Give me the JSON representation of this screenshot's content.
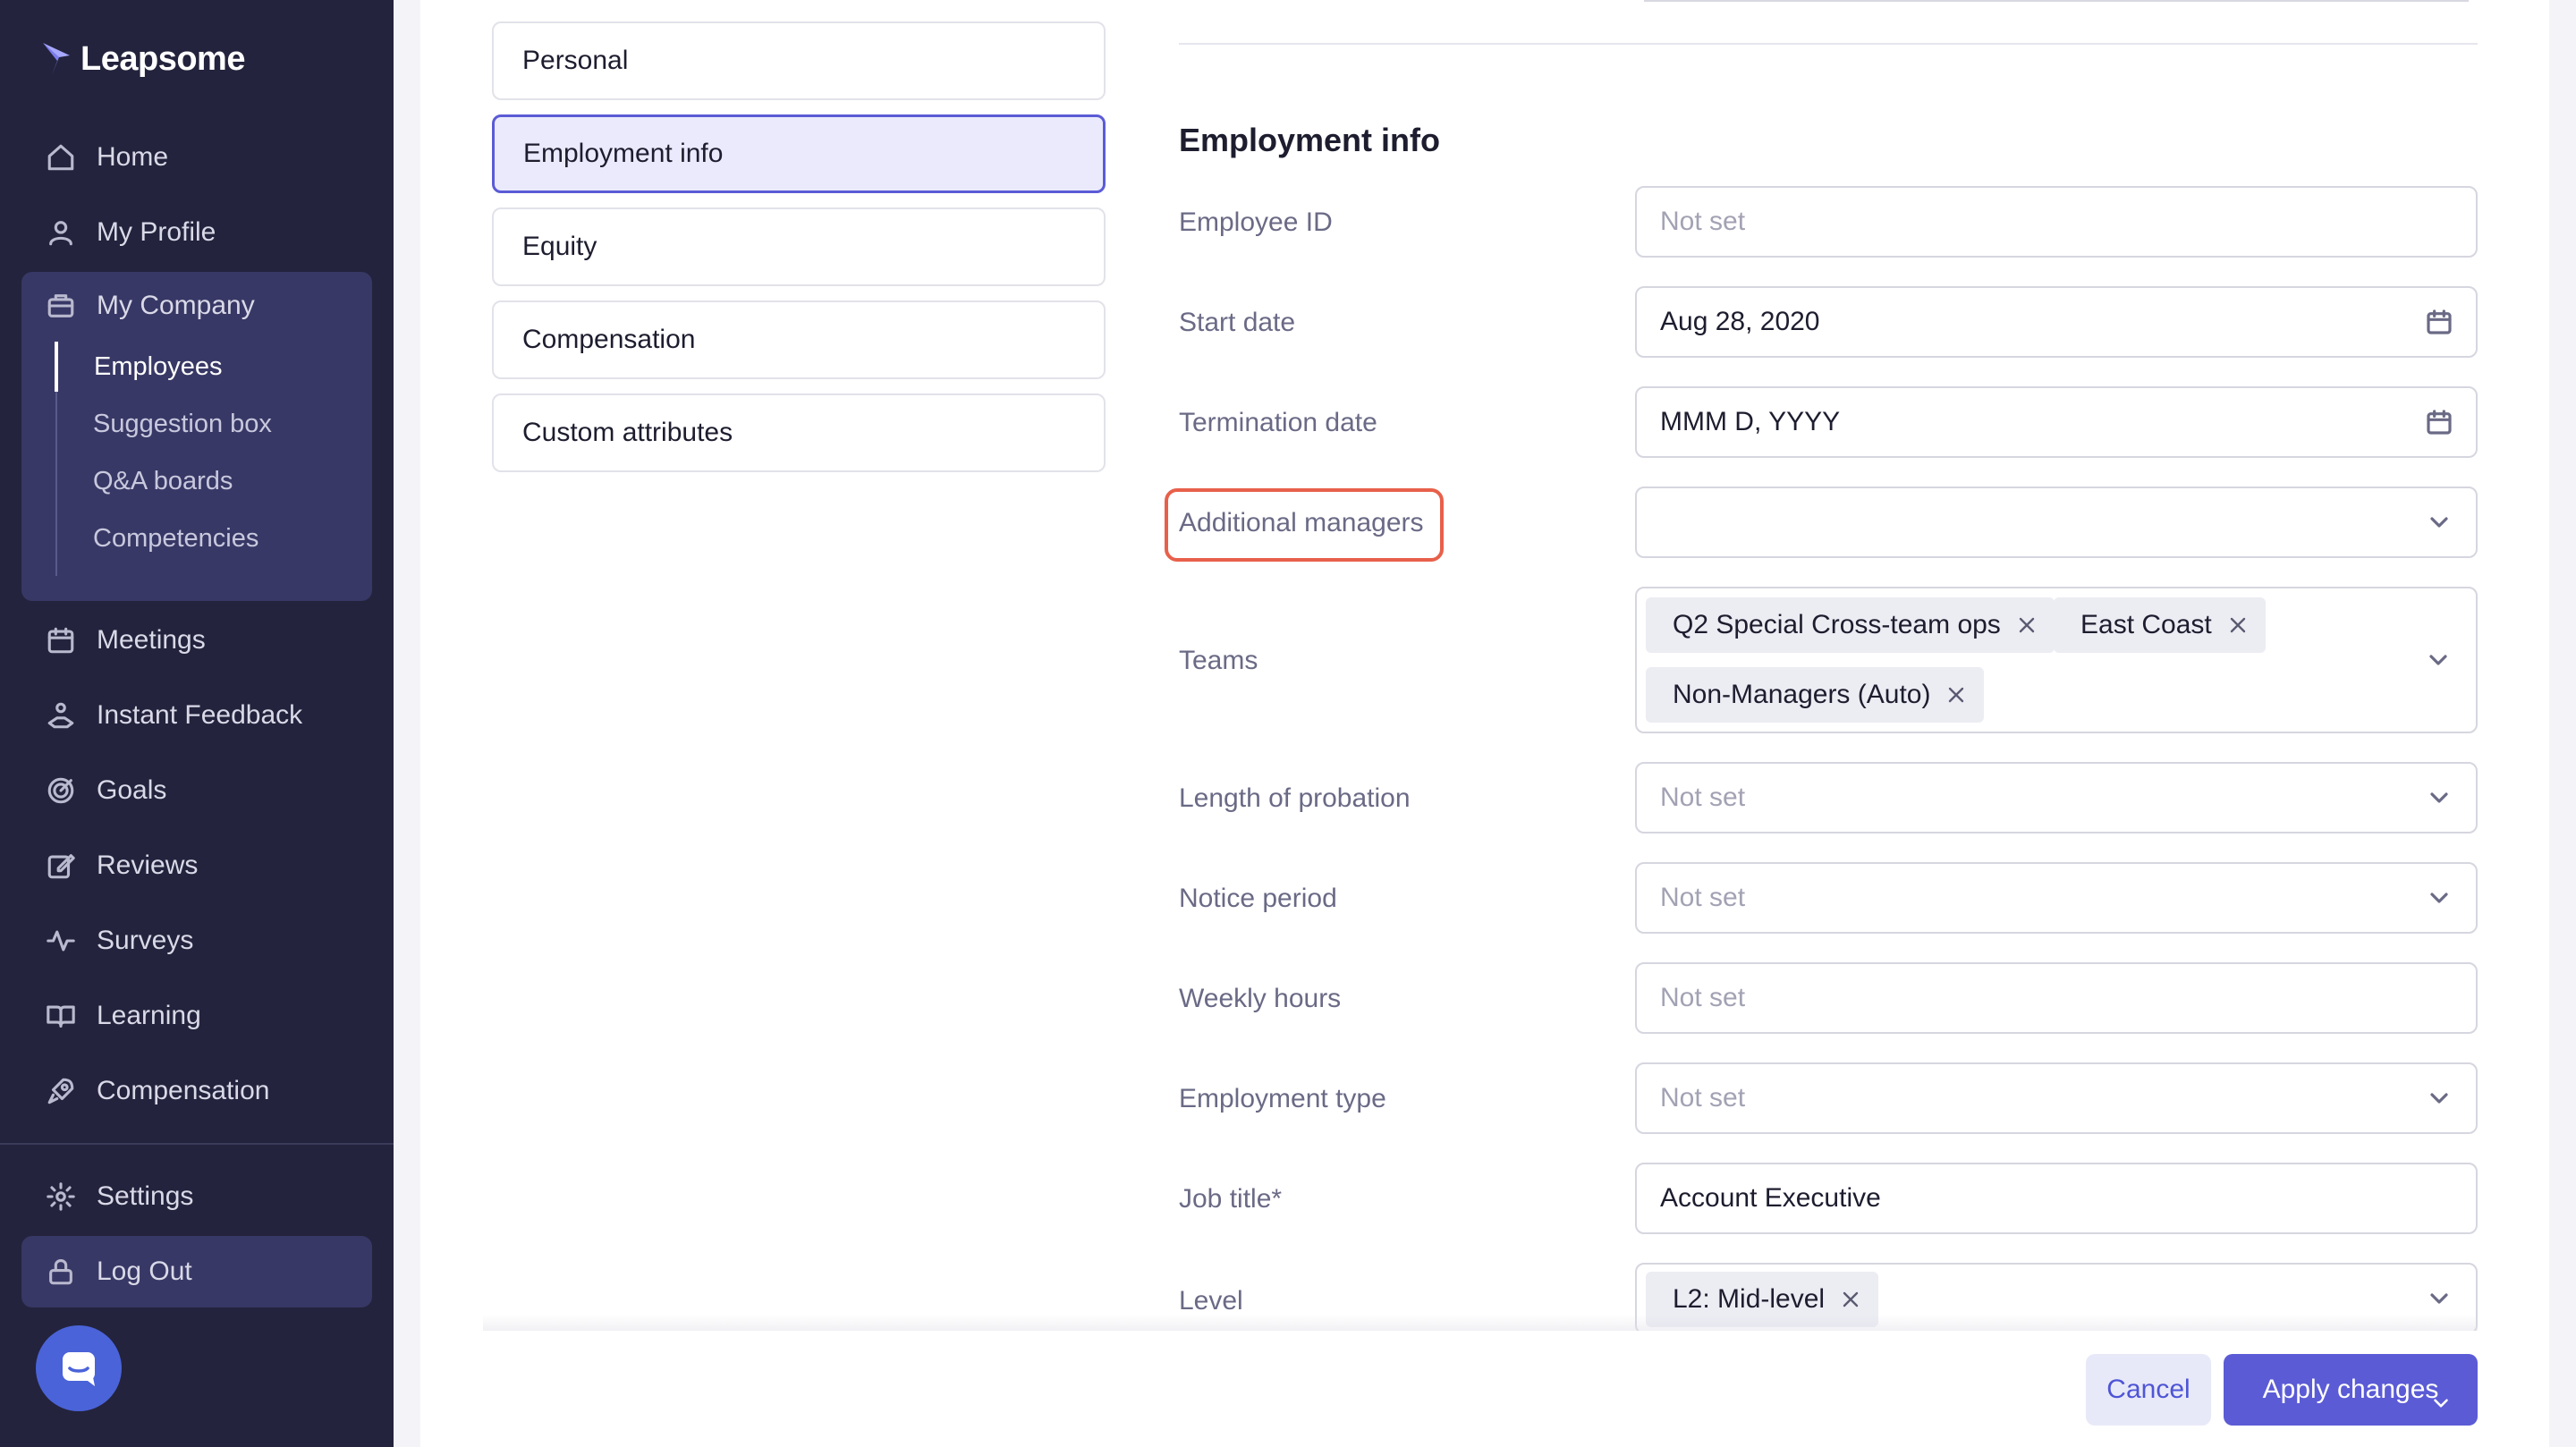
{
  "app": {
    "name": "Leapsome"
  },
  "sidebar": {
    "items": [
      {
        "label": "Home",
        "icon": "home-icon"
      },
      {
        "label": "My Profile",
        "icon": "user-icon"
      },
      {
        "label": "My Company",
        "icon": "briefcase-icon"
      },
      {
        "label": "Meetings",
        "icon": "calendar-icon"
      },
      {
        "label": "Instant Feedback",
        "icon": "feedback-hand-icon"
      },
      {
        "label": "Goals",
        "icon": "target-icon"
      },
      {
        "label": "Reviews",
        "icon": "edit-icon"
      },
      {
        "label": "Surveys",
        "icon": "pulse-icon"
      },
      {
        "label": "Learning",
        "icon": "book-icon"
      },
      {
        "label": "Compensation",
        "icon": "rocket-icon"
      }
    ],
    "company_subitems": [
      {
        "label": "Employees",
        "active": true
      },
      {
        "label": "Suggestion box"
      },
      {
        "label": "Q&A boards"
      },
      {
        "label": "Competencies"
      }
    ],
    "settings_label": "Settings",
    "logout_label": "Log Out"
  },
  "sections": [
    {
      "label": "Personal"
    },
    {
      "label": "Employment info",
      "active": true
    },
    {
      "label": "Equity"
    },
    {
      "label": "Compensation"
    },
    {
      "label": "Custom attributes"
    }
  ],
  "form": {
    "title": "Employment info",
    "fields": {
      "employee_id": {
        "label": "Employee ID",
        "placeholder": "Not set"
      },
      "start_date": {
        "label": "Start date",
        "value": "Aug 28, 2020"
      },
      "termination_date": {
        "label": "Termination date",
        "value": "MMM D, YYYY"
      },
      "additional_managers": {
        "label": "Additional managers",
        "value": ""
      },
      "teams": {
        "label": "Teams",
        "chips": [
          "Q2 Special Cross-team ops",
          "East Coast",
          "Non-Managers (Auto)"
        ]
      },
      "length_of_probation": {
        "label": "Length of probation",
        "placeholder": "Not set"
      },
      "notice_period": {
        "label": "Notice period",
        "placeholder": "Not set"
      },
      "weekly_hours": {
        "label": "Weekly hours",
        "placeholder": "Not set"
      },
      "employment_type": {
        "label": "Employment type",
        "placeholder": "Not set"
      },
      "job_title": {
        "label": "Job title*",
        "value": "Account Executive"
      },
      "level": {
        "label": "Level",
        "chips": [
          "L2: Mid-level"
        ]
      }
    }
  },
  "footer": {
    "cancel_label": "Cancel",
    "apply_label": "Apply changes"
  },
  "colors": {
    "sidebar_bg": "#23233d",
    "sidebar_active_bg": "#383866",
    "accent": "#5b5bd6",
    "highlight": "#e8604a"
  }
}
